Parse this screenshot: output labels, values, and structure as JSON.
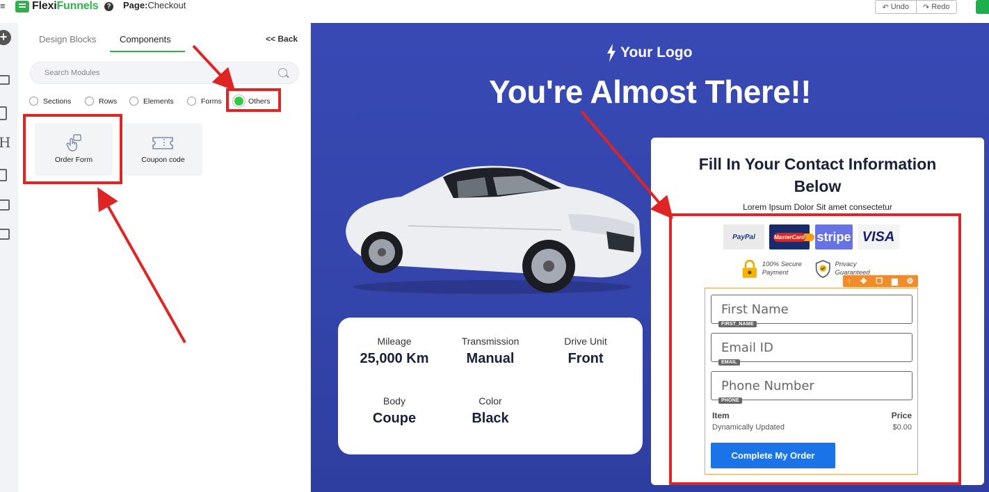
{
  "app": {
    "brand_prefix": "Flexi",
    "brand_suffix": "Funnels",
    "page_label": "Page:",
    "page_name": "Checkout",
    "undo": "Undo",
    "redo": "Redo",
    "accent": "#2eb14a"
  },
  "panel": {
    "tabs": [
      {
        "label": "Design Blocks",
        "active": false
      },
      {
        "label": "Components",
        "active": true
      }
    ],
    "back": "<< Back",
    "search_placeholder": "Search Modules",
    "filters": [
      {
        "label": "Sections",
        "selected": false
      },
      {
        "label": "Rows",
        "selected": false
      },
      {
        "label": "Elements",
        "selected": false
      },
      {
        "label": "Forms",
        "selected": false
      },
      {
        "label": "Others",
        "selected": true
      }
    ],
    "modules": [
      {
        "label": "Order Form",
        "icon": "hand-pointer-icon"
      },
      {
        "label": "Coupon code",
        "icon": "ticket-icon"
      }
    ]
  },
  "canvas": {
    "logo": "Your Logo",
    "headline": "You're Almost There!!",
    "specs": [
      {
        "key": "Mileage",
        "value": "25,000 Km"
      },
      {
        "key": "Transmission",
        "value": "Manual"
      },
      {
        "key": "Drive Unit",
        "value": "Front"
      },
      {
        "key": "Body",
        "value": "Coupe"
      },
      {
        "key": "Color",
        "value": "Black"
      }
    ],
    "form": {
      "title": "Fill In Your Contact Information Below",
      "subtitle": "Lorem Ipsum Dolor Sit amet consectetur",
      "payments": [
        "PayPal",
        "MasterCard",
        "stripe",
        "VISA"
      ],
      "secure": "100% Secure Payment",
      "privacy": "Privacy Guaranteed",
      "fields": [
        {
          "placeholder": "First Name",
          "tag": "FIRST_NAME"
        },
        {
          "placeholder": "Email ID",
          "tag": "EMAIL"
        },
        {
          "placeholder": "Phone Number",
          "tag": "PHONE"
        }
      ],
      "item_header": "Item",
      "price_header": "Price",
      "item_value": "Dynamically Updated",
      "price_value": "$0.00",
      "submit": "Complete My Order"
    }
  }
}
